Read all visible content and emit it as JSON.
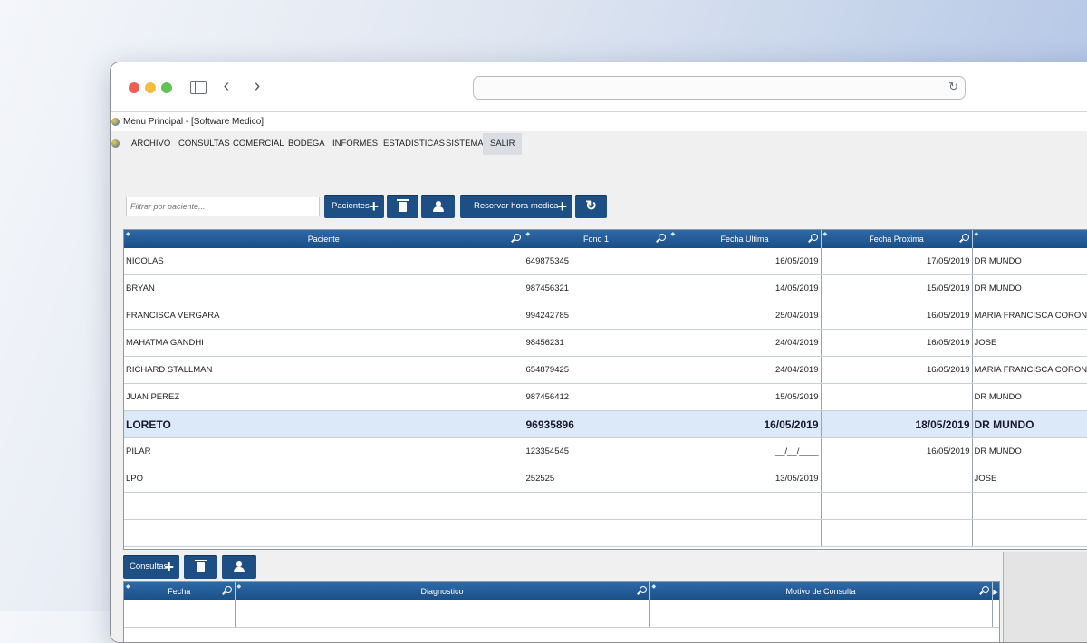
{
  "window": {
    "title": "Menu Principal - [Software Medico]"
  },
  "menu": {
    "items": [
      "ARCHIVO",
      "CONSULTAS",
      "COMERCIAL",
      "BODEGA",
      "INFORMES",
      "ESTADISTICAS",
      "SISTEMA",
      "SALIR"
    ],
    "active": "SALIR"
  },
  "toolbar": {
    "filter_placeholder": "Filtrar por paciente...",
    "pacientes_label": "Pacientes",
    "reservar_label": "Reservar hora medica"
  },
  "patients_table": {
    "columns": [
      "Paciente",
      "Fono 1",
      "Fecha Ultima",
      "Fecha Proxima",
      ""
    ],
    "rows": [
      {
        "paciente": "NICOLAS",
        "fono": "649875345",
        "ultima": "16/05/2019",
        "proxima": "17/05/2019",
        "doctor": "DR MUNDO"
      },
      {
        "paciente": "BRYAN",
        "fono": "987456321",
        "ultima": "14/05/2019",
        "proxima": "15/05/2019",
        "doctor": "DR MUNDO"
      },
      {
        "paciente": "FRANCISCA VERGARA",
        "fono": "994242785",
        "ultima": "25/04/2019",
        "proxima": "16/05/2019",
        "doctor": "MARIA FRANCISCA CORONA HUMP"
      },
      {
        "paciente": "MAHATMA GANDHI",
        "fono": "98456231",
        "ultima": "24/04/2019",
        "proxima": "16/05/2019",
        "doctor": "JOSE"
      },
      {
        "paciente": "RICHARD STALLMAN",
        "fono": "654879425",
        "ultima": "24/04/2019",
        "proxima": "16/05/2019",
        "doctor": "MARIA FRANCISCA CORONA HUMP"
      },
      {
        "paciente": "JUAN PEREZ",
        "fono": "987456412",
        "ultima": "15/05/2019",
        "proxima": "",
        "doctor": "DR MUNDO"
      },
      {
        "paciente": "LORETO",
        "fono": "96935896",
        "ultima": "16/05/2019",
        "proxima": "18/05/2019",
        "doctor": "DR MUNDO",
        "selected": true
      },
      {
        "paciente": "PILAR",
        "fono": "123354545",
        "ultima": "__/__/____",
        "proxima": "16/05/2019",
        "doctor": "DR MUNDO"
      },
      {
        "paciente": "LPO",
        "fono": "252525",
        "ultima": "13/05/2019",
        "proxima": "",
        "doctor": "JOSE"
      }
    ]
  },
  "consultas_toolbar": {
    "consultas_label": "Consultas"
  },
  "consultas_table": {
    "columns": [
      "Fecha",
      "Diagnostico",
      "Motivo de Consulta"
    ]
  }
}
